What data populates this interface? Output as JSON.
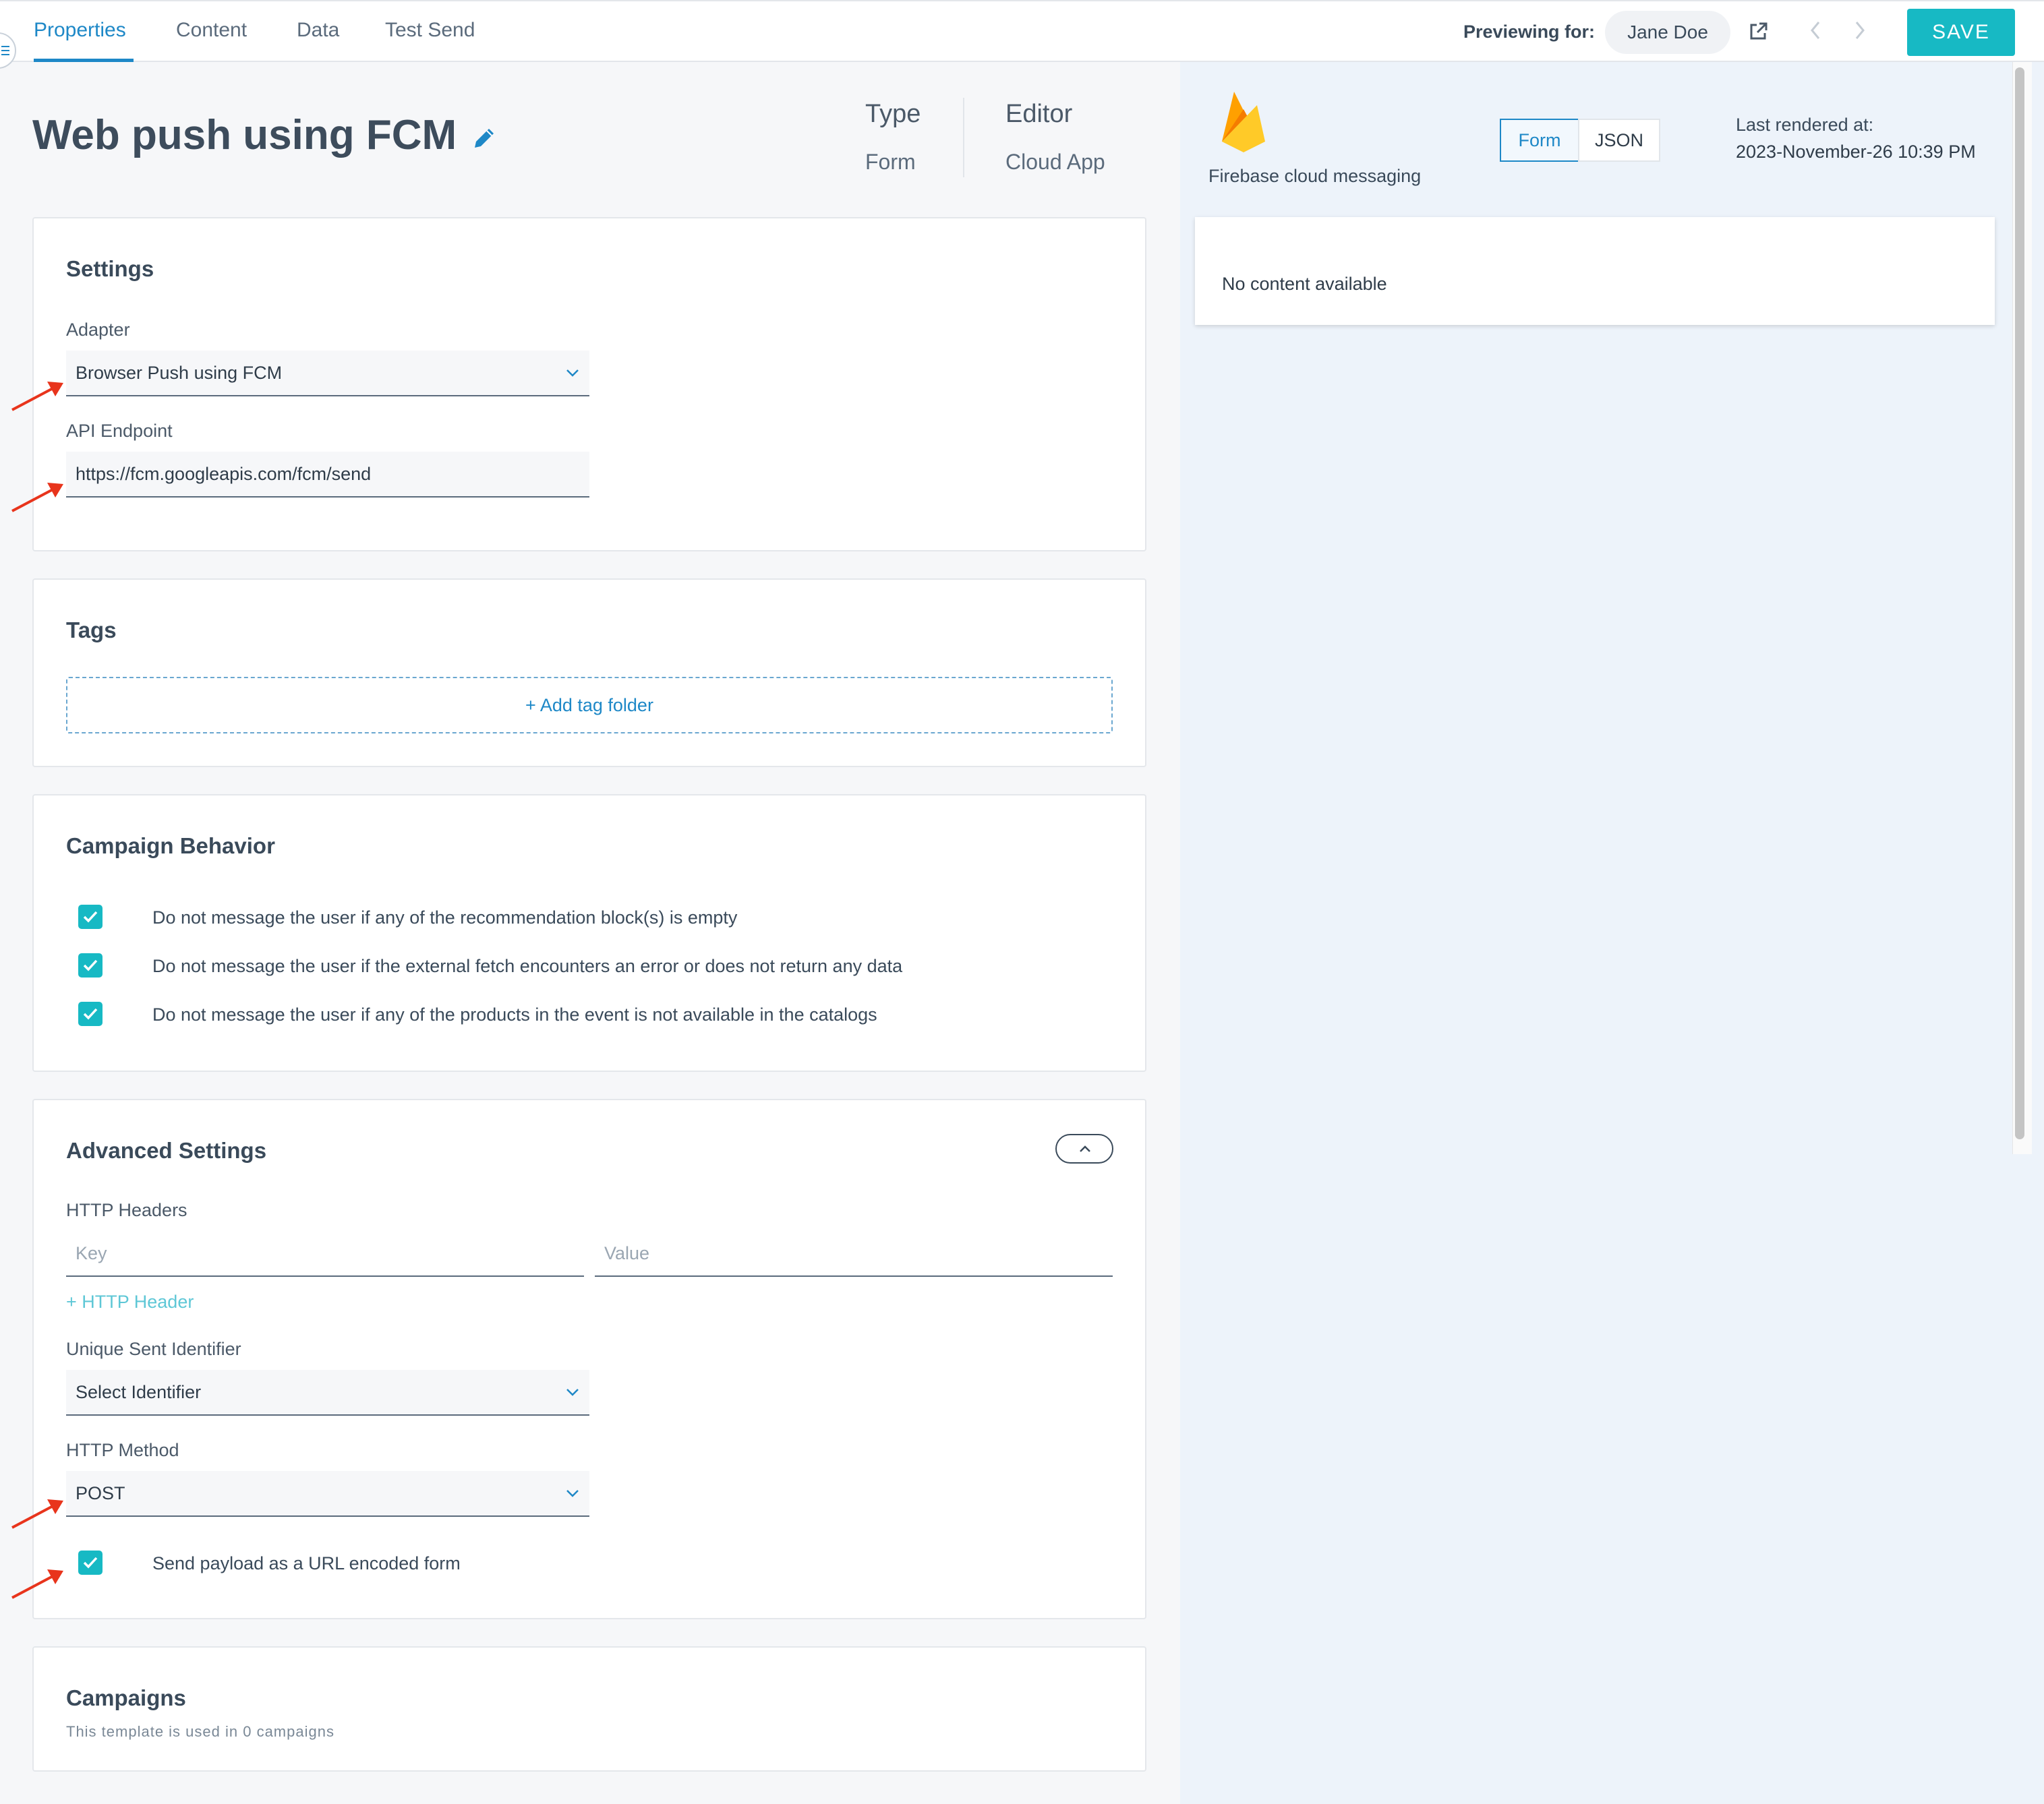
{
  "tabs": [
    {
      "label": "Properties"
    },
    {
      "label": "Content"
    },
    {
      "label": "Data"
    },
    {
      "label": "Test Send"
    }
  ],
  "preview": {
    "label": "Previewing for:",
    "user": "Jane Doe"
  },
  "save_label": "SAVE",
  "template": {
    "title": "Web push using FCM",
    "type_label": "Type",
    "type_value": "Form",
    "editor_label": "Editor",
    "editor_value": "Cloud App"
  },
  "settings": {
    "title": "Settings",
    "adapter_label": "Adapter",
    "adapter_value": "Browser Push using FCM",
    "endpoint_label": "API Endpoint",
    "endpoint_value": "https://fcm.googleapis.com/fcm/send"
  },
  "tags": {
    "title": "Tags",
    "add_label": "+ Add tag folder"
  },
  "behavior": {
    "title": "Campaign Behavior",
    "options": [
      {
        "label": "Do not message the user if any of the recommendation block(s) is empty",
        "checked": true
      },
      {
        "label": "Do not message the user if the external fetch encounters an error or does not return any data",
        "checked": true
      },
      {
        "label": "Do not message the user if any of the products in the event is not available in the catalogs",
        "checked": true
      }
    ]
  },
  "advanced": {
    "title": "Advanced Settings",
    "headers_label": "HTTP Headers",
    "key_placeholder": "Key",
    "value_placeholder": "Value",
    "add_header_label": "+ HTTP Header",
    "identifier_label": "Unique Sent Identifier",
    "identifier_value": "Select Identifier",
    "method_label": "HTTP Method",
    "method_value": "POST",
    "url_encoded_label": "Send payload as a URL encoded form",
    "url_encoded_checked": true
  },
  "campaigns": {
    "title": "Campaigns",
    "usage": "This template is used in 0 campaigns"
  },
  "right": {
    "provider_name": "Firebase cloud messaging",
    "view_toggle": [
      "Form",
      "JSON"
    ],
    "active_view": "Form",
    "last_rendered_label": "Last rendered at:",
    "last_rendered_value": "2023-November-26 10:39 PM",
    "empty_message": "No content available"
  },
  "colors": {
    "accent": "#1e88c7",
    "teal": "#17b9c4",
    "annotation_arrow": "#e8341c"
  },
  "icons": [
    "menu-icon",
    "pencil-icon",
    "external-link-icon",
    "chevron-left-icon",
    "chevron-right-icon",
    "chevron-down-icon",
    "chevron-up-icon",
    "checkmark-icon",
    "firebase-logo"
  ]
}
